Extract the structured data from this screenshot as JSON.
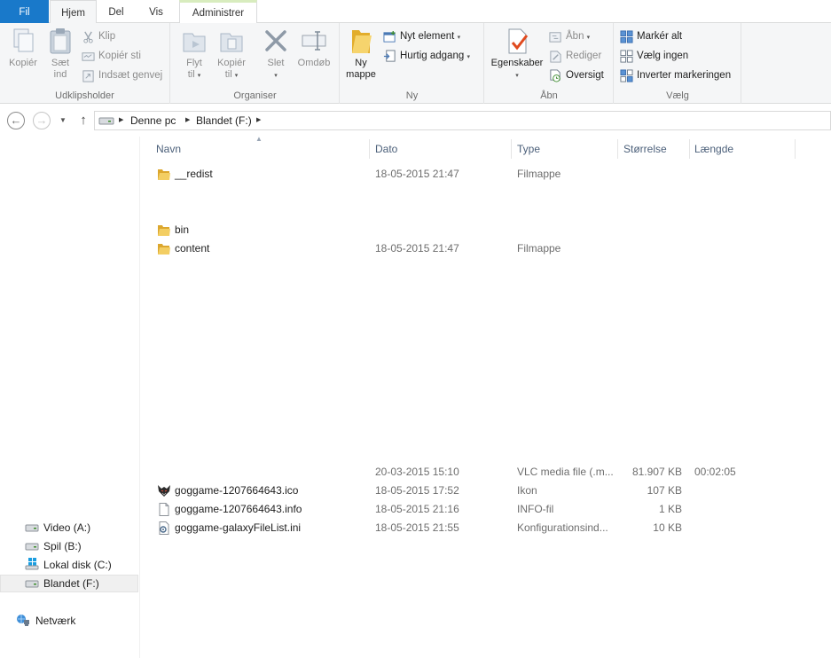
{
  "tabs": {
    "file": "Fil",
    "home": "Hjem",
    "share": "Del",
    "view": "Vis",
    "admin": "Administrer"
  },
  "ribbon": {
    "clipboard": {
      "label": "Udklipsholder",
      "copy": "Kopiér",
      "paste_l1": "Sæt",
      "paste_l2": "ind",
      "cut": "Klip",
      "copy_path": "Kopiér sti",
      "paste_shortcut": "Indsæt genvej"
    },
    "organize": {
      "label": "Organiser",
      "move_l1": "Flyt",
      "move_l2": "til",
      "copy_l1": "Kopiér",
      "copy_l2": "til",
      "delete": "Slet",
      "rename": "Omdøb"
    },
    "new": {
      "label": "Ny",
      "new_folder_l1": "Ny",
      "new_folder_l2": "mappe",
      "new_item": "Nyt element",
      "easy_access": "Hurtig adgang"
    },
    "open": {
      "label": "Åbn",
      "properties": "Egenskaber",
      "open": "Åbn",
      "edit": "Rediger",
      "history": "Oversigt"
    },
    "select": {
      "label": "Vælg",
      "select_all": "Markér alt",
      "select_none": "Vælg ingen",
      "invert": "Inverter markeringen"
    }
  },
  "address": {
    "crumbs": [
      "Denne pc",
      "Blandet (F:)"
    ]
  },
  "nav": {
    "items": [
      {
        "label": "Video (A:)",
        "icon": "drive-icon"
      },
      {
        "label": "Spil (B:)",
        "icon": "drive-icon"
      },
      {
        "label": "Lokal disk (C:)",
        "icon": "windows-drive-icon"
      },
      {
        "label": "Blandet (F:)",
        "icon": "drive-icon",
        "selected": true
      },
      {
        "label": "Netværk",
        "icon": "network-icon"
      }
    ]
  },
  "columns": {
    "name": "Navn",
    "date": "Dato",
    "type": "Type",
    "size": "Størrelse",
    "length": "Længde"
  },
  "files": [
    {
      "name": "__redist",
      "date": "18-05-2015 21:47",
      "type": "Filmappe",
      "size": "",
      "length": "",
      "icon": "folder-icon"
    },
    {
      "name": "bin",
      "date": "",
      "type": "",
      "size": "",
      "length": "",
      "icon": "folder-icon"
    },
    {
      "name": "content",
      "date": "18-05-2015 21:47",
      "type": "Filmappe",
      "size": "",
      "length": "",
      "icon": "folder-icon"
    },
    {
      "name": "",
      "date": "20-03-2015 15:10",
      "type": "VLC media file (.m...",
      "size": "81.907 KB",
      "length": "00:02:05",
      "icon": ""
    },
    {
      "name": "goggame-1207664643.ico",
      "date": "18-05-2015 17:52",
      "type": "Ikon",
      "size": "107 KB",
      "length": "",
      "icon": "wolf-icon"
    },
    {
      "name": "goggame-1207664643.info",
      "date": "18-05-2015 21:16",
      "type": "INFO-fil",
      "size": "1 KB",
      "length": "",
      "icon": "document-icon"
    },
    {
      "name": "goggame-galaxyFileList.ini",
      "date": "18-05-2015 21:55",
      "type": "Konfigurationsind...",
      "size": "10 KB",
      "length": "",
      "icon": "settings-file-icon"
    }
  ],
  "colors": {
    "file_tab": "#1979ca",
    "ribbon_bg": "#f5f6f7",
    "folder": "#e8b93c",
    "header_text": "#4c607a"
  }
}
